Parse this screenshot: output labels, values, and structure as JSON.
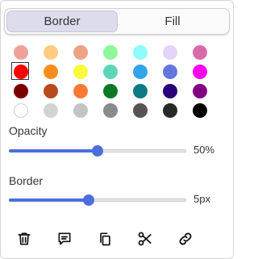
{
  "tabs": [
    {
      "label": "Border",
      "active": true
    },
    {
      "label": "Fill",
      "active": false
    }
  ],
  "swatches": [
    {
      "color": "#f0a09a",
      "name": "swatch-light-red"
    },
    {
      "color": "#fecb80",
      "name": "swatch-light-orange"
    },
    {
      "color": "#f0a285",
      "name": "swatch-salmon"
    },
    {
      "color": "#8df79a",
      "name": "swatch-light-green"
    },
    {
      "color": "#8ffcfc",
      "name": "swatch-light-cyan"
    },
    {
      "color": "#e3d3f8",
      "name": "swatch-lavender"
    },
    {
      "color": "#da69a8",
      "name": "swatch-pink"
    },
    {
      "color": "#ff0000",
      "name": "swatch-red",
      "selected": true
    },
    {
      "color": "#fa8c1e",
      "name": "swatch-orange"
    },
    {
      "color": "#fafa3c",
      "name": "swatch-yellow"
    },
    {
      "color": "#5cd6b8",
      "name": "swatch-teal-green"
    },
    {
      "color": "#32a4e8",
      "name": "swatch-sky-blue"
    },
    {
      "color": "#6377de",
      "name": "swatch-periwinkle"
    },
    {
      "color": "#ff00f0",
      "name": "swatch-magenta"
    },
    {
      "color": "#7a0000",
      "name": "swatch-maroon"
    },
    {
      "color": "#b84a1e",
      "name": "swatch-rust"
    },
    {
      "color": "#fa7a32",
      "name": "swatch-dark-orange"
    },
    {
      "color": "#0c7a24",
      "name": "swatch-dark-green"
    },
    {
      "color": "#0c7a82",
      "name": "swatch-dark-teal"
    },
    {
      "color": "#28007a",
      "name": "swatch-indigo"
    },
    {
      "color": "#820082",
      "name": "swatch-purple"
    },
    {
      "color": "#ffffff",
      "name": "swatch-white",
      "light": true
    },
    {
      "color": "#d2d2d2",
      "name": "swatch-light-gray"
    },
    {
      "color": "#c4c4c4",
      "name": "swatch-silver"
    },
    {
      "color": "#8a8a8a",
      "name": "swatch-gray"
    },
    {
      "color": "#585454",
      "name": "swatch-dark-gray"
    },
    {
      "color": "#282828",
      "name": "swatch-charcoal"
    },
    {
      "color": "#000000",
      "name": "swatch-black"
    }
  ],
  "opacity": {
    "label": "Opacity",
    "value_text": "50%",
    "fraction": 0.5
  },
  "border": {
    "label": "Border",
    "value_text": "5px",
    "fraction": 0.45
  },
  "accent_color": "#4a6fdc",
  "actions": [
    {
      "icon": "trash-icon",
      "name": "delete-button"
    },
    {
      "icon": "comment-icon",
      "name": "comment-button"
    },
    {
      "icon": "copy-icon",
      "name": "duplicate-button"
    },
    {
      "icon": "scissors-icon",
      "name": "cut-button"
    },
    {
      "icon": "link-icon",
      "name": "link-button"
    }
  ]
}
